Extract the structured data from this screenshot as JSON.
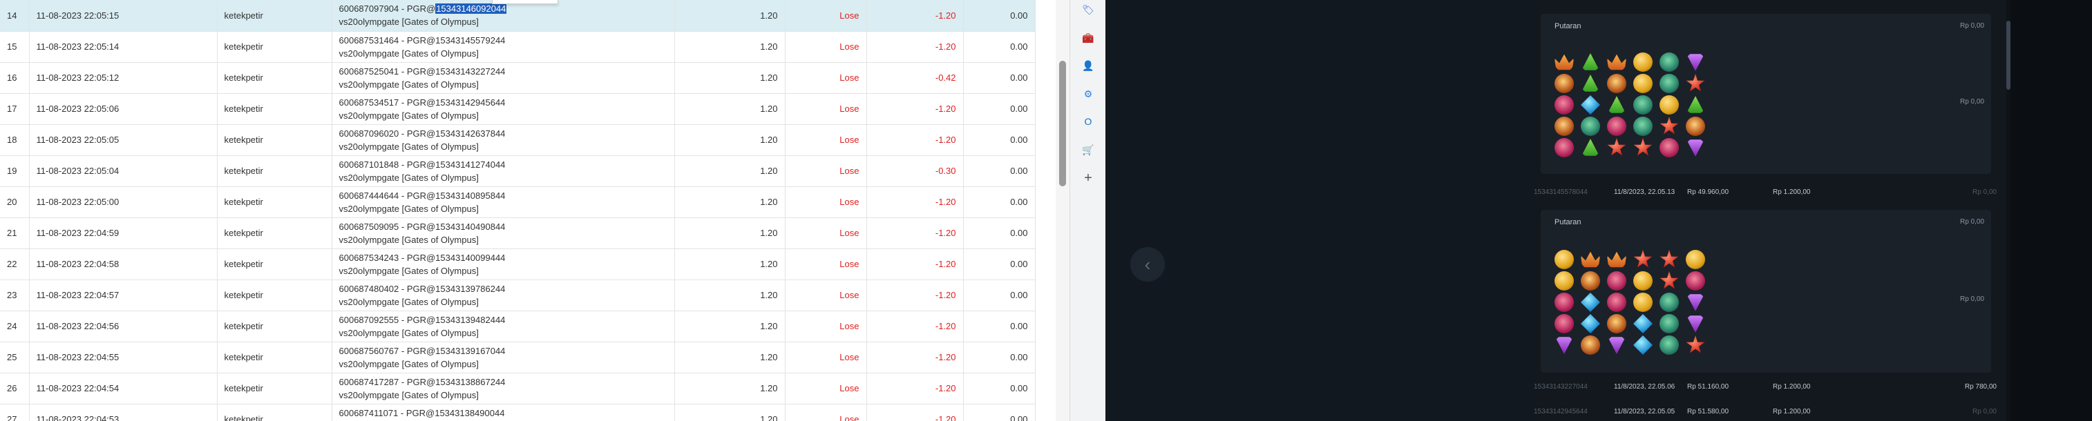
{
  "table": {
    "rows": [
      {
        "no": "14",
        "date": "11-08-2023 22:05:15",
        "user": "ketekpetir",
        "desc_id": "600687097904 - PGR@",
        "desc_id_hl": "15343146092044",
        "desc_game": "vs20olympgate [Gates of Olympus]",
        "stake": "1.20",
        "result": "Lose",
        "winloss": "-1.20",
        "balance": "0.00",
        "selected": true
      },
      {
        "no": "15",
        "date": "11-08-2023 22:05:14",
        "user": "ketekpetir",
        "desc_id": "600687531464 - PGR@15343145579244",
        "desc_id_hl": "",
        "desc_game": "vs20olympgate [Gates of Olympus]",
        "stake": "1.20",
        "result": "Lose",
        "winloss": "-1.20",
        "balance": "0.00"
      },
      {
        "no": "16",
        "date": "11-08-2023 22:05:12",
        "user": "ketekpetir",
        "desc_id": "600687525041 - PGR@15343143227244",
        "desc_id_hl": "",
        "desc_game": "vs20olympgate [Gates of Olympus]",
        "stake": "1.20",
        "result": "Lose",
        "winloss": "-0.42",
        "balance": "0.00"
      },
      {
        "no": "17",
        "date": "11-08-2023 22:05:06",
        "user": "ketekpetir",
        "desc_id": "600687534517 - PGR@15343142945644",
        "desc_id_hl": "",
        "desc_game": "vs20olympgate [Gates of Olympus]",
        "stake": "1.20",
        "result": "Lose",
        "winloss": "-1.20",
        "balance": "0.00"
      },
      {
        "no": "18",
        "date": "11-08-2023 22:05:05",
        "user": "ketekpetir",
        "desc_id": "600687096020 - PGR@15343142637844",
        "desc_id_hl": "",
        "desc_game": "vs20olympgate [Gates of Olympus]",
        "stake": "1.20",
        "result": "Lose",
        "winloss": "-1.20",
        "balance": "0.00"
      },
      {
        "no": "19",
        "date": "11-08-2023 22:05:04",
        "user": "ketekpetir",
        "desc_id": "600687101848 - PGR@15343141274044",
        "desc_id_hl": "",
        "desc_game": "vs20olympgate [Gates of Olympus]",
        "stake": "1.20",
        "result": "Lose",
        "winloss": "-0.30",
        "balance": "0.00"
      },
      {
        "no": "20",
        "date": "11-08-2023 22:05:00",
        "user": "ketekpetir",
        "desc_id": "600687444644 - PGR@15343140895844",
        "desc_id_hl": "",
        "desc_game": "vs20olympgate [Gates of Olympus]",
        "stake": "1.20",
        "result": "Lose",
        "winloss": "-1.20",
        "balance": "0.00"
      },
      {
        "no": "21",
        "date": "11-08-2023 22:04:59",
        "user": "ketekpetir",
        "desc_id": "600687509095 - PGR@15343140490844",
        "desc_id_hl": "",
        "desc_game": "vs20olympgate [Gates of Olympus]",
        "stake": "1.20",
        "result": "Lose",
        "winloss": "-1.20",
        "balance": "0.00"
      },
      {
        "no": "22",
        "date": "11-08-2023 22:04:58",
        "user": "ketekpetir",
        "desc_id": "600687534243 - PGR@15343140099444",
        "desc_id_hl": "",
        "desc_game": "vs20olympgate [Gates of Olympus]",
        "stake": "1.20",
        "result": "Lose",
        "winloss": "-1.20",
        "balance": "0.00"
      },
      {
        "no": "23",
        "date": "11-08-2023 22:04:57",
        "user": "ketekpetir",
        "desc_id": "600687480402 - PGR@15343139786244",
        "desc_id_hl": "",
        "desc_game": "vs20olympgate [Gates of Olympus]",
        "stake": "1.20",
        "result": "Lose",
        "winloss": "-1.20",
        "balance": "0.00"
      },
      {
        "no": "24",
        "date": "11-08-2023 22:04:56",
        "user": "ketekpetir",
        "desc_id": "600687092555 - PGR@15343139482444",
        "desc_id_hl": "",
        "desc_game": "vs20olympgate [Gates of Olympus]",
        "stake": "1.20",
        "result": "Lose",
        "winloss": "-1.20",
        "balance": "0.00"
      },
      {
        "no": "25",
        "date": "11-08-2023 22:04:55",
        "user": "ketekpetir",
        "desc_id": "600687560767 - PGR@15343139167044",
        "desc_id_hl": "",
        "desc_game": "vs20olympgate [Gates of Olympus]",
        "stake": "1.20",
        "result": "Lose",
        "winloss": "-1.20",
        "balance": "0.00"
      },
      {
        "no": "26",
        "date": "11-08-2023 22:04:54",
        "user": "ketekpetir",
        "desc_id": "600687417287 - PGR@15343138867244",
        "desc_id_hl": "",
        "desc_game": "vs20olympgate [Gates of Olympus]",
        "stake": "1.20",
        "result": "Lose",
        "winloss": "-1.20",
        "balance": "0.00"
      },
      {
        "no": "27",
        "date": "11-08-2023 22:04:53",
        "user": "ketekpetir",
        "desc_id": "600687411071 - PGR@15343138490044",
        "desc_id_hl": "",
        "desc_game": "vs20olympgate [Gates of Olympus]",
        "stake": "1.20",
        "result": "Lose",
        "winloss": "-1.20",
        "balance": "0.00"
      }
    ]
  },
  "extensions": [
    {
      "name": "tag-extension-icon",
      "glyph": "🏷",
      "color": "#3b6fd6"
    },
    {
      "name": "briefcase-extension-icon",
      "glyph": "🧰",
      "color": "#c8302a"
    },
    {
      "name": "person-extension-icon",
      "glyph": "👤",
      "color": "#7a4fc2"
    },
    {
      "name": "gear-extension-icon",
      "glyph": "⚙",
      "color": "#2f7de1"
    },
    {
      "name": "outlook-extension-icon",
      "glyph": "O",
      "color": "#1a73c8"
    },
    {
      "name": "cart-extension-icon",
      "glyph": "🛒",
      "color": "#2f86d6"
    },
    {
      "name": "add-extension-icon",
      "glyph": "+",
      "color": "#555555"
    }
  ],
  "history": {
    "card1": {
      "title": "Putaran",
      "amount_top": "Rp 0,00",
      "amount_mid": "Rp 0,00",
      "grid": [
        "crown",
        "green",
        "crown",
        "gold",
        "ring",
        "purple",
        "cup",
        "green",
        "cup",
        "gold",
        "ring",
        "red",
        "pink",
        "blue",
        "green",
        "ring",
        "gold",
        "green",
        "cup",
        "ring",
        "pink",
        "ring",
        "red",
        "cup",
        "pink",
        "green",
        "red",
        "red",
        "pink",
        "purple"
      ]
    },
    "row1": {
      "id": "15343145578044",
      "date": "11/8/2023, 22.05.13",
      "balance": "Rp 49.960,00",
      "bet": "Rp 1.200,00",
      "win": "Rp 0,00"
    },
    "card2": {
      "title": "Putaran",
      "amount_top": "Rp 0,00",
      "amount_mid": "Rp 0,00",
      "grid": [
        "gold",
        "crown",
        "crown",
        "red",
        "red",
        "gold",
        "gold",
        "cup",
        "pink",
        "gold",
        "red",
        "pink",
        "pink",
        "blue",
        "pink",
        "gold",
        "ring",
        "purple",
        "pink",
        "blue",
        "cup",
        "blue",
        "ring",
        "purple",
        "purple",
        "cup",
        "purple",
        "blue",
        "ring",
        "red"
      ]
    },
    "row2": {
      "id": "15343143227044",
      "date": "11/8/2023, 22.05.06",
      "balance": "Rp 51.160,00",
      "bet": "Rp 1.200,00",
      "win": "Rp 780,00"
    },
    "row3": {
      "id": "15343142945644",
      "date": "11/8/2023, 22.05.05",
      "balance": "Rp 51.580,00",
      "bet": "Rp 1.200,00",
      "win": "Rp 0,00"
    }
  }
}
